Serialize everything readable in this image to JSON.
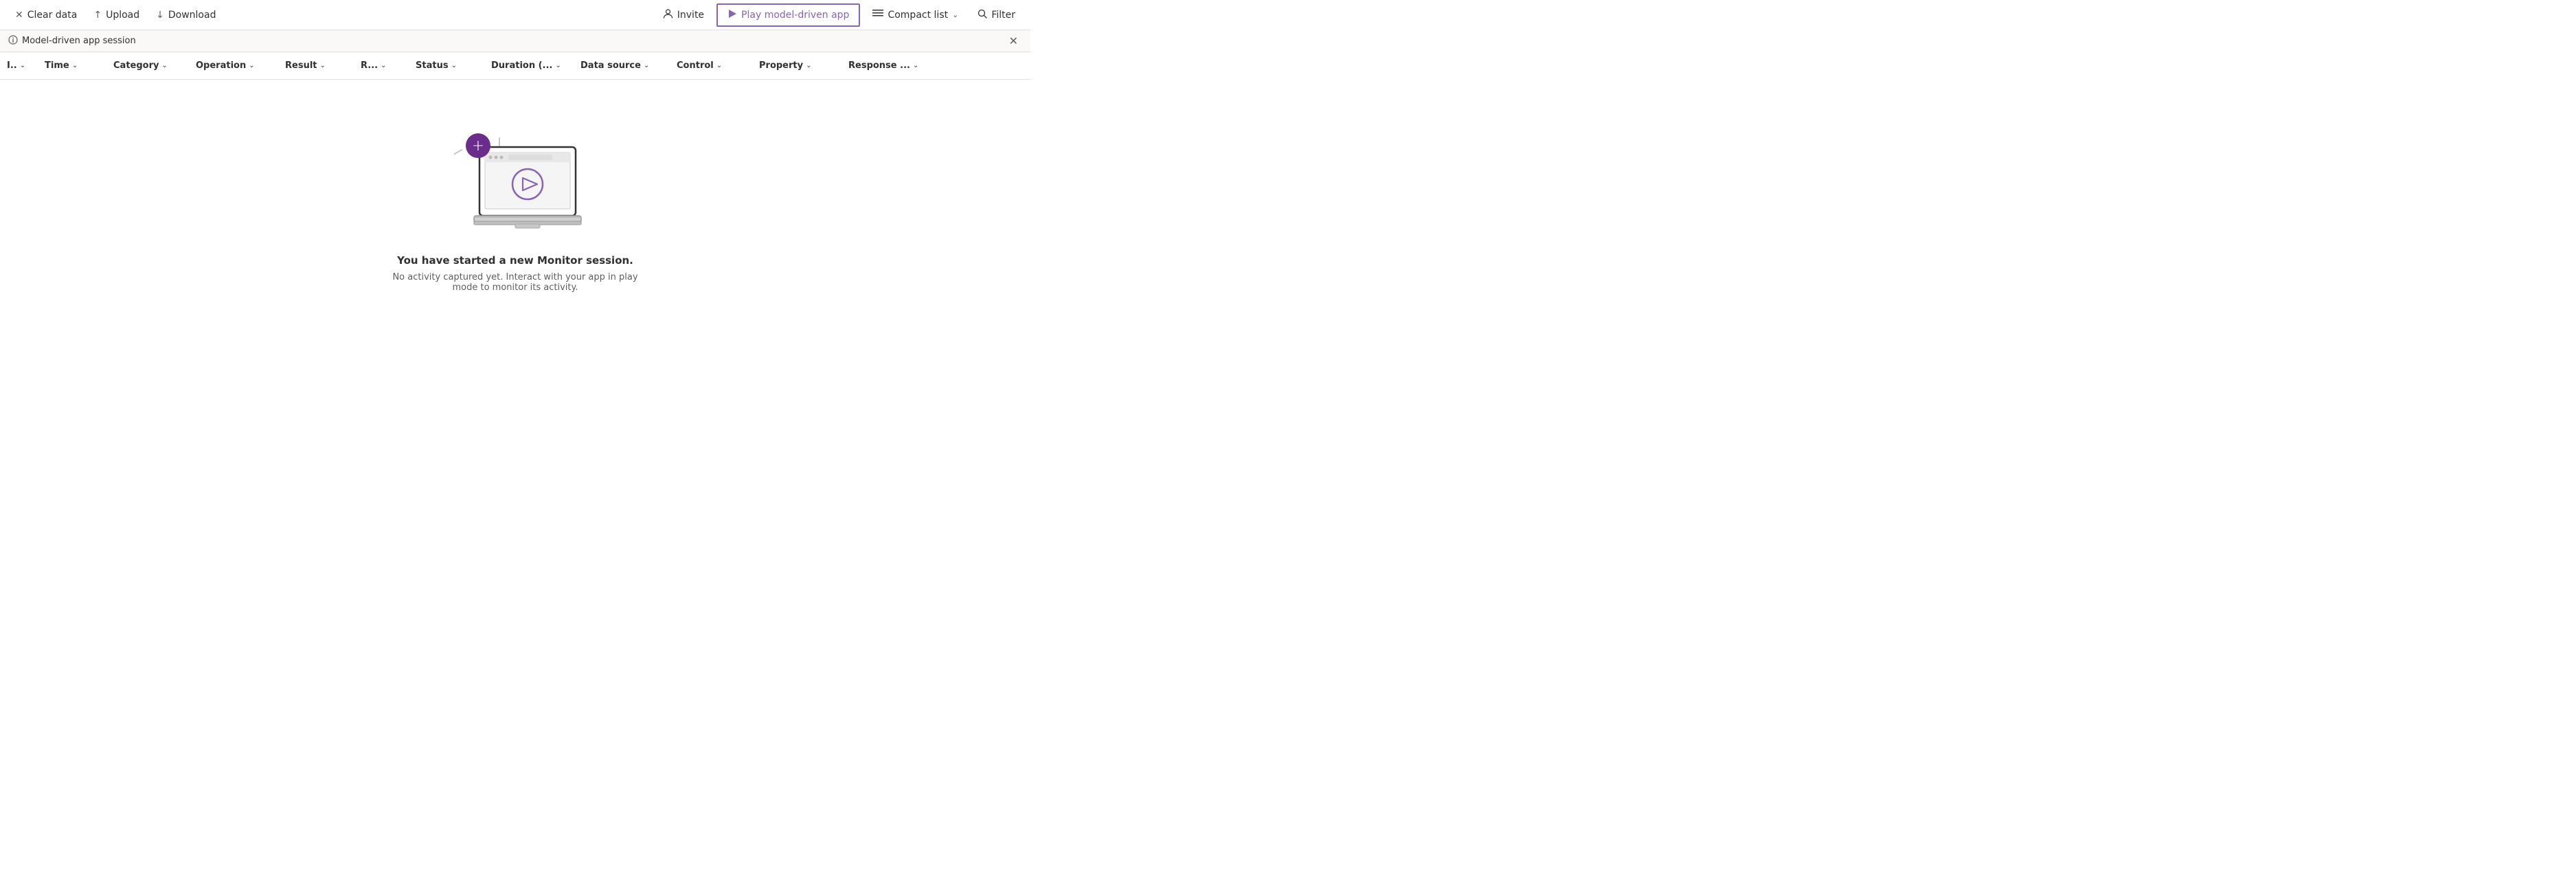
{
  "toolbar": {
    "clear_data_label": "Clear data",
    "upload_label": "Upload",
    "download_label": "Download",
    "invite_label": "Invite",
    "play_model_driven_app_label": "Play model-driven app",
    "compact_list_label": "Compact list",
    "filter_label": "Filter"
  },
  "info_bar": {
    "text": "Model-driven app session"
  },
  "columns": [
    {
      "id": "col-id",
      "label": "I..",
      "has_chevron": true
    },
    {
      "id": "col-time",
      "label": "Time",
      "has_chevron": true
    },
    {
      "id": "col-category",
      "label": "Category",
      "has_chevron": true
    },
    {
      "id": "col-operation",
      "label": "Operation",
      "has_chevron": true
    },
    {
      "id": "col-result",
      "label": "Result",
      "has_chevron": true
    },
    {
      "id": "col-r",
      "label": "R...",
      "has_chevron": true
    },
    {
      "id": "col-status",
      "label": "Status",
      "has_chevron": true
    },
    {
      "id": "col-duration",
      "label": "Duration (...",
      "has_chevron": true
    },
    {
      "id": "col-datasource",
      "label": "Data source",
      "has_chevron": true
    },
    {
      "id": "col-control",
      "label": "Control",
      "has_chevron": true
    },
    {
      "id": "col-property",
      "label": "Property",
      "has_chevron": true
    },
    {
      "id": "col-response",
      "label": "Response ...",
      "has_chevron": true
    }
  ],
  "empty_state": {
    "title": "You have started a new Monitor session.",
    "subtitle": "No activity captured yet. Interact with your app in play mode to monitor its activity."
  },
  "icons": {
    "clear": "✕",
    "upload": "↑",
    "download": "↓",
    "invite": "👤",
    "play": "▷",
    "compact_list": "≡",
    "filter": "🔍",
    "chevron_down": "⌄",
    "info": "ⓘ",
    "close": "✕"
  }
}
